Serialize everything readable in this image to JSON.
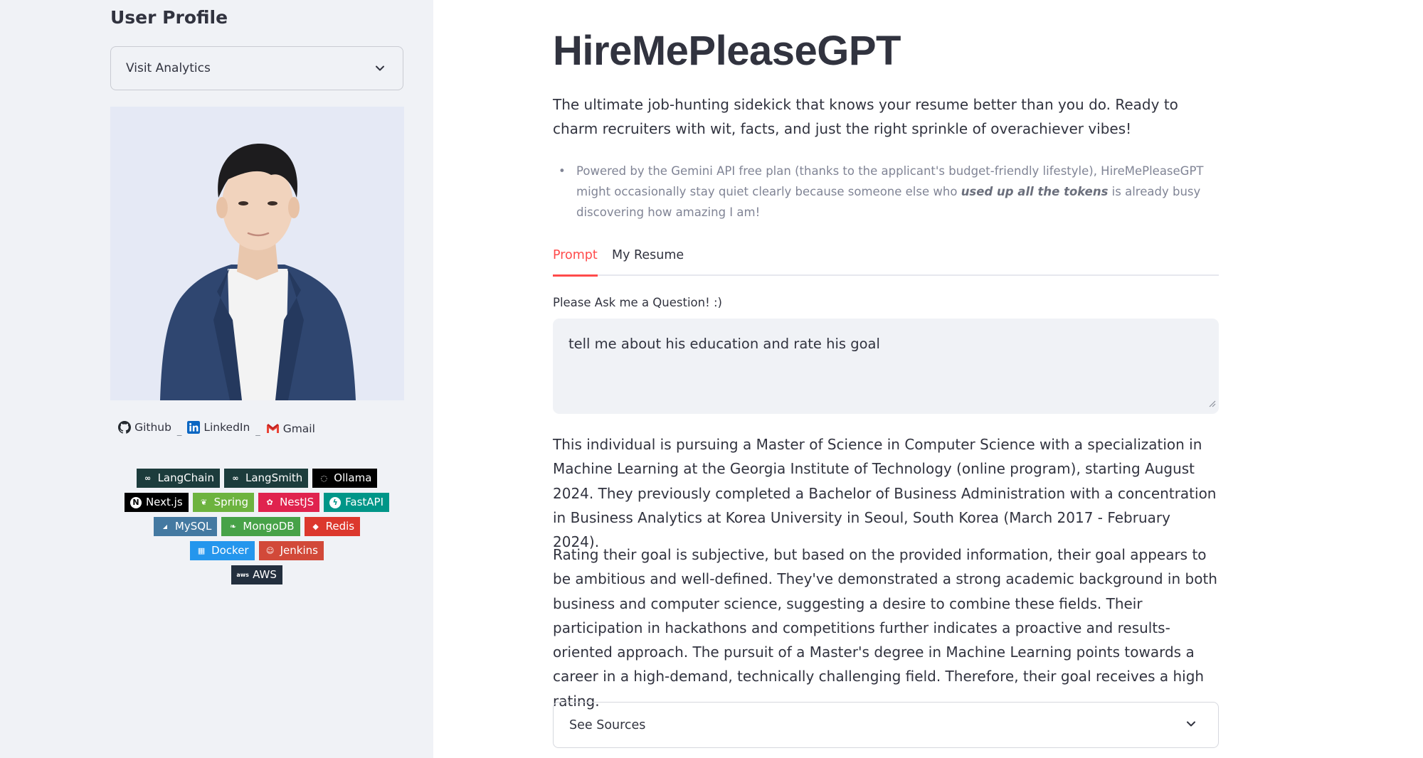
{
  "sidebar": {
    "title": "User Profile",
    "select": {
      "value": "Visit Analytics"
    },
    "links": [
      {
        "label": "Github",
        "icon": "github-icon"
      },
      {
        "label": "LinkedIn",
        "icon": "linkedin-icon"
      },
      {
        "label": "Gmail",
        "icon": "gmail-icon"
      }
    ],
    "badges": [
      {
        "label": "LangChain",
        "color": "#1c3c3c"
      },
      {
        "label": "LangSmith",
        "color": "#1c3c3c"
      },
      {
        "label": "Ollama",
        "color": "#000000"
      },
      {
        "label": "Next.js",
        "color": "#000000"
      },
      {
        "label": "Spring",
        "color": "#6db33f"
      },
      {
        "label": "NestJS",
        "color": "#e0234e"
      },
      {
        "label": "FastAPI",
        "color": "#009688"
      },
      {
        "label": "MySQL",
        "color": "#4479a1"
      },
      {
        "label": "MongoDB",
        "color": "#47a248"
      },
      {
        "label": "Redis",
        "color": "#dc382d"
      },
      {
        "label": "Docker",
        "color": "#2496ed"
      },
      {
        "label": "Jenkins",
        "color": "#d24939"
      },
      {
        "label": "AWS",
        "color": "#232f3e"
      }
    ]
  },
  "main": {
    "title": "HireMePleaseGPT",
    "intro": "The ultimate job-hunting sidekick that knows your resume better than you do. Ready to charm recruiters with wit, facts, and just the right sprinkle of overachiever vibes!",
    "note": {
      "before": "Powered by the Gemini API free plan (thanks to the applicant's budget-friendly lifestyle), HireMePleaseGPT might occasionally stay quiet clearly because someone else who ",
      "emphasis": "used up all the tokens",
      "after": " is already busy discovering how amazing I am!"
    },
    "tabs": [
      {
        "label": "Prompt",
        "active": true
      },
      {
        "label": "My Resume",
        "active": false
      }
    ],
    "question_label": "Please Ask me a Question! :)",
    "question_value": "tell me about his education and rate his goal",
    "answer": [
      "This individual is pursuing a Master of Science in Computer Science with a specialization in Machine Learning at the Georgia Institute of Technology (online program), starting August 2024. They previously completed a Bachelor of Business Administration with a concentration in Business Analytics at Korea University in Seoul, South Korea (March 2017 - February 2024).",
      "Rating their goal is subjective, but based on the provided information, their goal appears to be ambitious and well-defined. They've demonstrated a strong academic background in both business and computer science, suggesting a desire to combine these fields. Their participation in hackathons and competitions further indicates a proactive and results-oriented approach. The pursuit of a Master's degree in Machine Learning points towards a career in a high-demand, technically challenging field. Therefore, their goal receives a high rating."
    ],
    "expander_label": "See Sources"
  },
  "colors": {
    "accent": "#ff4b4b",
    "sidebar_bg": "#f0f2f6",
    "text": "#31333f"
  }
}
